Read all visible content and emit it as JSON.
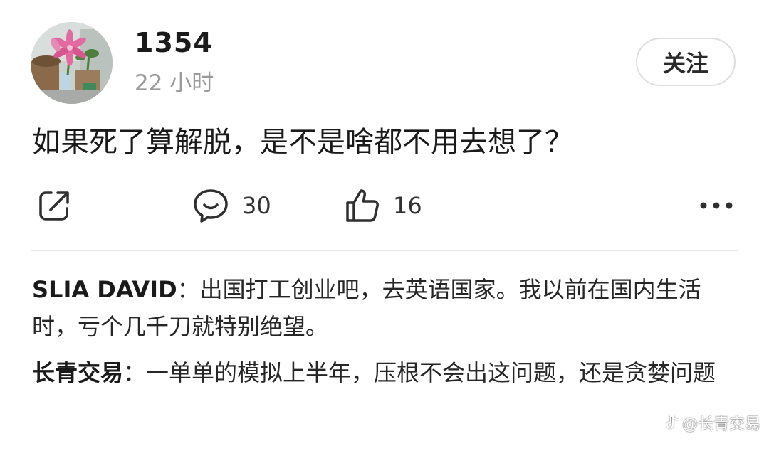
{
  "post": {
    "author": "1354",
    "time": "22 小时",
    "follow_label": "关注",
    "content": "如果死了算解脱，是不是啥都不用去想了？"
  },
  "actions": {
    "comment_count": "30",
    "like_count": "16",
    "icons": [
      "share-icon",
      "comment-icon",
      "like-icon",
      "more-icon"
    ]
  },
  "comments": [
    {
      "author": "SLIA DAVID",
      "separator": "：",
      "text": "出国打工创业吧，去英语国家。我以前在国内生活时，亏个几千刀就特别绝望。"
    },
    {
      "author": "长青交易",
      "separator": "：",
      "text": "一单单的模拟上半年，压根不会出这问题，还是贪婪问题"
    }
  ],
  "watermark": {
    "text": "@长青交易"
  },
  "colors": {
    "text": "#1a1a1a",
    "secondary": "#9a9a9a",
    "icon": "#2f2f2f",
    "divider": "#e6e6e6"
  }
}
